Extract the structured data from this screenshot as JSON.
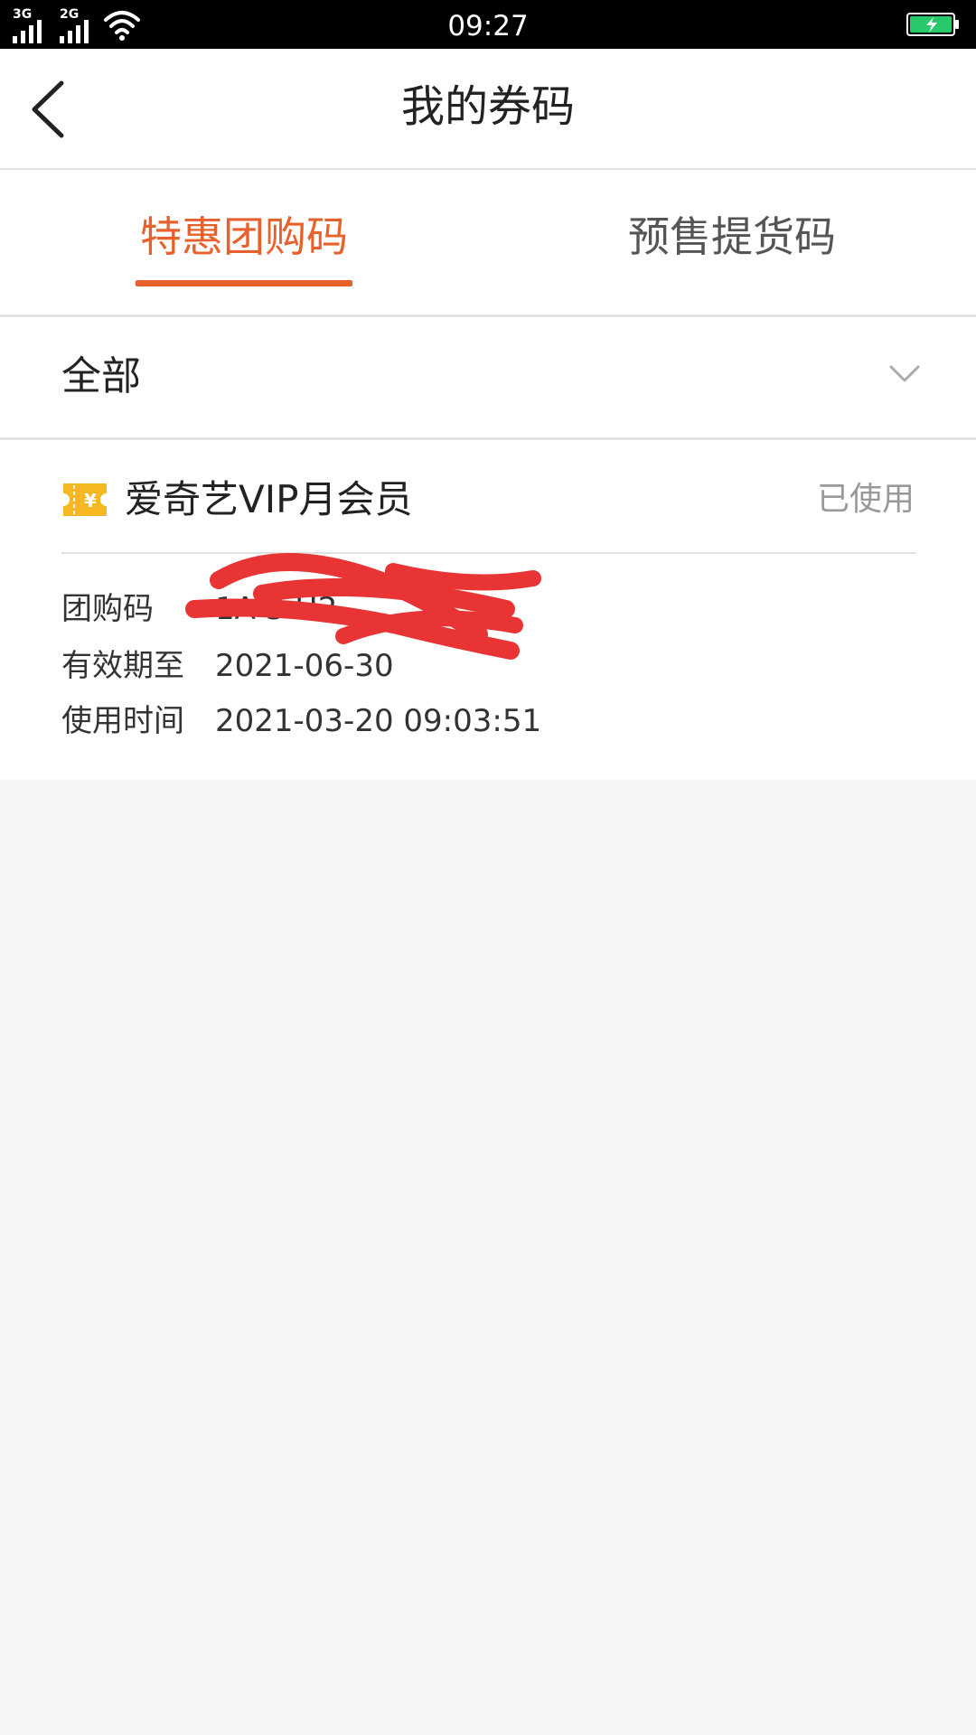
{
  "status_bar": {
    "network_1": "3G",
    "network_2": "2G",
    "time": "09:27"
  },
  "header": {
    "title": "我的券码"
  },
  "tabs": [
    {
      "label": "特惠团购码",
      "active": true
    },
    {
      "label": "预售提货码",
      "active": false
    }
  ],
  "filter": {
    "selected": "全部"
  },
  "coupon": {
    "name": "爱奇艺VIP月会员",
    "status": "已使用",
    "code_label": "团购码",
    "code_value": "1A        3        H2",
    "expiry_label": "有效期至",
    "expiry_value": "2021-06-30",
    "used_label": "使用时间",
    "used_value": "2021-03-20 09:03:51"
  },
  "colors": {
    "accent": "#e8602c",
    "ticket": "#f5b822",
    "battery": "#27c96b",
    "redaction": "#e83434"
  },
  "icons": [
    "back-arrow-icon",
    "chevron-down-icon",
    "ticket-icon",
    "wifi-icon",
    "signal-icon",
    "battery-charging-icon"
  ]
}
